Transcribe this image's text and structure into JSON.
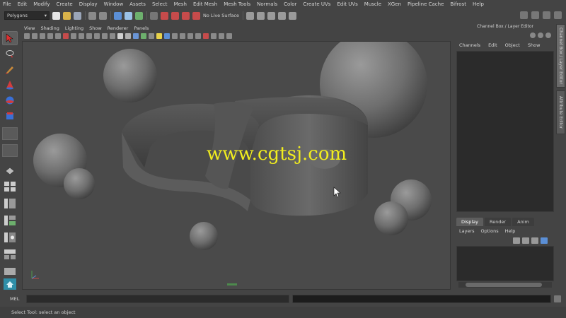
{
  "menubar": {
    "items": [
      "File",
      "Edit",
      "Modify",
      "Create",
      "Display",
      "Window",
      "Assets",
      "Select",
      "Mesh",
      "Edit Mesh",
      "Mesh Tools",
      "Normals",
      "Color",
      "Create UVs",
      "Edit UVs",
      "Muscle",
      "XGen",
      "Pipeline Cache",
      "Bifrost",
      "Help"
    ]
  },
  "statusline": {
    "mode": "Polygons",
    "live_surface": "No Live Surface"
  },
  "panel": {
    "menu": [
      "View",
      "Shading",
      "Lighting",
      "Show",
      "Renderer",
      "Panels"
    ]
  },
  "viewport": {
    "watermark": "www.cgtsj.com"
  },
  "right_panel": {
    "title": "Channel Box / Layer Editor",
    "side_tabs": [
      "Channel Box / Layer Editor",
      "Attribute Editor"
    ],
    "channel_menu": [
      "Channels",
      "Edit",
      "Object",
      "Show"
    ],
    "layer_tabs": [
      "Display",
      "Render",
      "Anim"
    ],
    "layer_menu": [
      "Layers",
      "Options",
      "Help"
    ]
  },
  "command_line": {
    "label": "MEL"
  },
  "help_line": {
    "text": "Select Tool: select an object"
  },
  "colors": {
    "ui_bg": "#444444",
    "field_bg": "#2b2b2b",
    "watermark": "#f2ee1e",
    "active_tab": "#5d5d5d"
  }
}
